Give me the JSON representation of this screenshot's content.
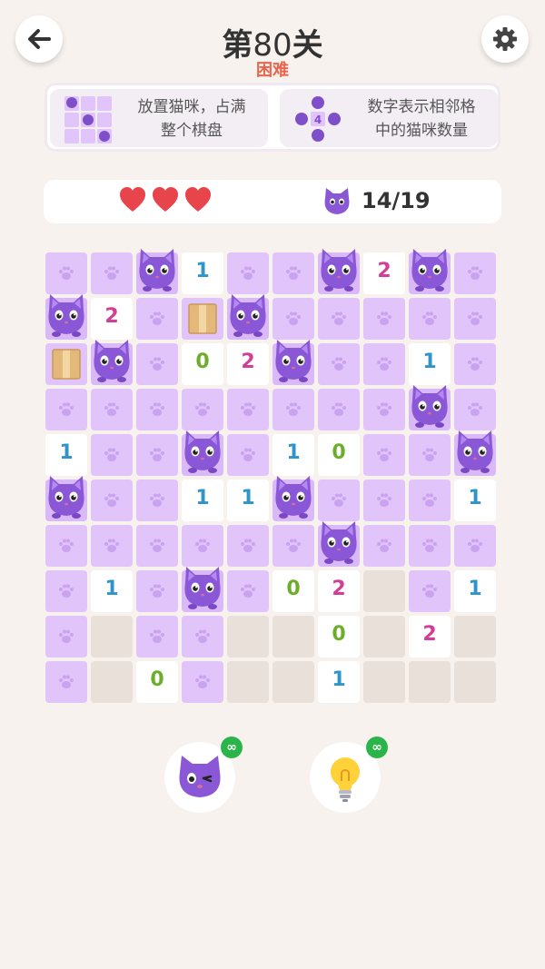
{
  "header": {
    "title_prefix": "第",
    "level": "80",
    "title_suffix": "关",
    "difficulty": "困难"
  },
  "rules": [
    {
      "text_line1": "放置猫咪，占满",
      "text_line2": "整个棋盘",
      "icon": "cat-placement-icon"
    },
    {
      "text_line1": "数字表示相邻格",
      "text_line2": "中的猫咪数量",
      "icon": "adjacent-count-icon",
      "sample_number": "4"
    }
  ],
  "status": {
    "lives": 3,
    "cat_count": "14/19"
  },
  "colors": {
    "paw": "#e0c4fa",
    "empty": "#e9e1d9",
    "num0": "#6cae2a",
    "num1": "#2d95c9",
    "num2": "#d43d95",
    "heart": "#e8444c"
  },
  "board": {
    "size": 10,
    "rows": [
      [
        "P",
        "P",
        "C",
        "1",
        "P",
        "P",
        "C",
        "2",
        "C",
        "P"
      ],
      [
        "C",
        "2",
        "P",
        "B",
        "C",
        "P",
        "P",
        "P",
        "P",
        "P"
      ],
      [
        "B",
        "C",
        "P",
        "0",
        "2",
        "C",
        "P",
        "P",
        "1",
        "P"
      ],
      [
        "P",
        "P",
        "P",
        "P",
        "P",
        "P",
        "P",
        "P",
        "C",
        "P"
      ],
      [
        "1",
        "P",
        "P",
        "C",
        "P",
        "1",
        "0",
        "P",
        "P",
        "C"
      ],
      [
        "C",
        "P",
        "P",
        "1",
        "1",
        "C",
        "P",
        "P",
        "P",
        "1"
      ],
      [
        "P",
        "P",
        "P",
        "P",
        "P",
        "P",
        "C",
        "P",
        "P",
        "P"
      ],
      [
        "P",
        "1",
        "P",
        "C",
        "P",
        "0",
        "2",
        "E",
        "P",
        "1"
      ],
      [
        "P",
        "E",
        "P",
        "P",
        "E",
        "E",
        "0",
        "E",
        "2",
        "E"
      ],
      [
        "P",
        "E",
        "0",
        "P",
        "E",
        "E",
        "1",
        "E",
        "E",
        "E"
      ]
    ]
  },
  "tools": [
    {
      "name": "cat-hint-tool",
      "badge": "∞"
    },
    {
      "name": "lightbulb-hint-tool",
      "badge": "∞"
    }
  ]
}
